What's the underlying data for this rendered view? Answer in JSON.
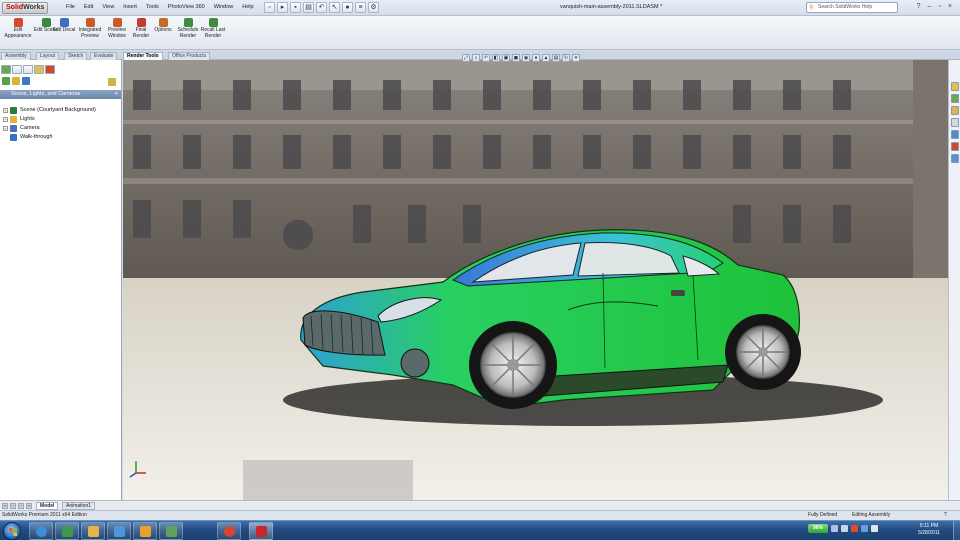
{
  "app": {
    "logo_solid": "Solid",
    "logo_works": "Works",
    "document_title": "vanquish-main-assembly-2011.SLDASM *",
    "menus": [
      "File",
      "Edit",
      "View",
      "Insert",
      "Tools",
      "PhotoView 360",
      "Window",
      "Help"
    ],
    "search_placeholder": "Search SolidWorks Help",
    "window_controls": [
      "?",
      "–",
      "▫",
      "×"
    ]
  },
  "ribbon": {
    "buttons": [
      {
        "label": "Edit Appearance",
        "icon": "appearance-icon",
        "color": "#d9462b"
      },
      {
        "label": "Edit Scene",
        "icon": "scene-icon",
        "color": "#3b8a3b"
      },
      {
        "label": "Edit Decal",
        "icon": "decal-icon",
        "color": "#3c6fc0"
      },
      {
        "label": "Integrated Preview",
        "icon": "integrated-preview-icon",
        "color": "#c75b2b"
      },
      {
        "label": "Preview Window",
        "icon": "preview-window-icon",
        "color": "#c75b2b"
      },
      {
        "label": "Final Render",
        "icon": "final-render-icon",
        "color": "#c23d2d"
      },
      {
        "label": "Options",
        "icon": "options-icon",
        "color": "#c46b2a"
      },
      {
        "label": "Schedule Render",
        "icon": "schedule-render-icon",
        "color": "#3d8d3d"
      },
      {
        "label": "Recall Last Render",
        "icon": "recall-render-icon",
        "color": "#3d8d3d"
      }
    ]
  },
  "command_tabs": [
    "Assembly",
    "Layout",
    "Sketch",
    "Evaluate",
    "Render Tools",
    "Office Products"
  ],
  "active_command_tab": "Render Tools",
  "left_panel": {
    "header": "Scene, Lights, and Cameras",
    "tree": [
      {
        "label": "Scene (Courtyard Background)",
        "icon": "scene-icon",
        "color": "#2f7a3a",
        "expander": "+"
      },
      {
        "label": "Lights",
        "icon": "lights-folder-icon",
        "color": "#e0b23a",
        "expander": "+"
      },
      {
        "label": "Camera",
        "icon": "camera-icon",
        "color": "#4b6fb0",
        "expander": "+"
      },
      {
        "label": "Walk-through",
        "icon": "walk-through-icon",
        "color": "#3a6fc4",
        "expander": ""
      }
    ]
  },
  "model_tabs": [
    "Model",
    "Animation1"
  ],
  "active_model_tab": "Model",
  "status": {
    "left": "SolidWorks Premium 2011 x64 Edition",
    "fully_defined": "Fully Defined",
    "editing": "Editing Assembly"
  },
  "taskbar": {
    "battery": "96%",
    "time": "5:11 PM",
    "date": "5/28/2011",
    "apps": [
      {
        "name": "ie-icon",
        "color": "#3b8fd6"
      },
      {
        "name": "explorer-icon",
        "color": "#3f9a4a"
      },
      {
        "name": "file-explorer-icon",
        "color": "#e3b64a"
      },
      {
        "name": "folder-icon",
        "color": "#4a98d9"
      },
      {
        "name": "outlook-icon",
        "color": "#e8a12a"
      },
      {
        "name": "dependency-icon",
        "color": "#5fa35a"
      },
      {
        "name": "chrome-icon",
        "color": "#d8452f"
      },
      {
        "name": "solidworks-icon",
        "color": "#c8262a"
      }
    ]
  }
}
